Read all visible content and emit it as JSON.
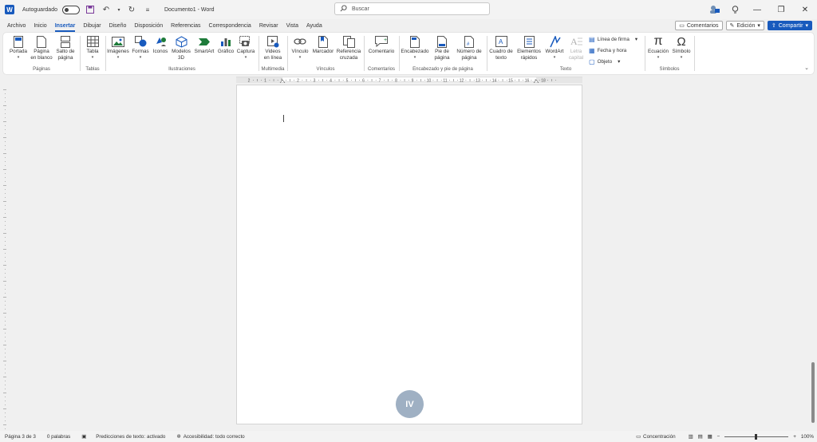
{
  "titlebar": {
    "autosave_label": "Autoguardado",
    "document_title": "Documento1 - Word",
    "search_placeholder": "Buscar"
  },
  "tabs": [
    {
      "label": "Archivo"
    },
    {
      "label": "Inicio"
    },
    {
      "label": "Insertar",
      "active": true
    },
    {
      "label": "Dibujar"
    },
    {
      "label": "Diseño"
    },
    {
      "label": "Disposición"
    },
    {
      "label": "Referencias"
    },
    {
      "label": "Correspondencia"
    },
    {
      "label": "Revisar"
    },
    {
      "label": "Vista"
    },
    {
      "label": "Ayuda"
    }
  ],
  "tabs_right": {
    "comments": "Comentarios",
    "editing": "Edición",
    "share": "Compartir"
  },
  "ribbon": {
    "paginas": {
      "label": "Páginas",
      "portada": "Portada",
      "pagina1": "Página",
      "pagina2": "en blanco",
      "salto1": "Salto de",
      "salto2": "página"
    },
    "tablas": {
      "label": "Tablas",
      "tabla": "Tabla"
    },
    "ilustraciones": {
      "label": "Ilustraciones",
      "imagenes": "Imágenes",
      "formas": "Formas",
      "iconos": "Iconos",
      "modelos1": "Modelos",
      "modelos2": "3D",
      "smartart": "SmartArt",
      "grafico": "Gráfico",
      "captura": "Captura"
    },
    "multimedia": {
      "label": "Multimedia",
      "videos1": "Videos",
      "videos2": "en línea"
    },
    "vinculos": {
      "label": "Vínculos",
      "vinculo": "Vínculo",
      "marcador": "Marcador",
      "ref1": "Referencia",
      "ref2": "cruzada"
    },
    "comentarios": {
      "label": "Comentarios",
      "comentario": "Comentario"
    },
    "encabezado": {
      "label": "Encabezado y pie de página",
      "encabezado": "Encabezado",
      "pie1": "Pie de",
      "pie2": "página",
      "num1": "Número de",
      "num2": "página"
    },
    "texto": {
      "label": "Texto",
      "cuadro1": "Cuadro de",
      "cuadro2": "texto",
      "elem1": "Elementos",
      "elem2": "rápidos",
      "wordart": "WordArt",
      "letra1": "Letra",
      "letra2": "capital",
      "linea_firma": "Línea de firma",
      "fecha_hora": "Fecha y hora",
      "objeto": "Objeto"
    },
    "simbolos": {
      "label": "Símbolos",
      "ecuacion": "Ecuación",
      "simbolo": "Símbolo"
    }
  },
  "ruler_numbers": [
    "2",
    "1",
    "1",
    "2",
    "3",
    "4",
    "5",
    "6",
    "7",
    "8",
    "9",
    "10",
    "11",
    "12",
    "13",
    "14",
    "15",
    "16",
    "18"
  ],
  "document": {
    "page_badge": "IV"
  },
  "statusbar": {
    "page": "Página 3 de 3",
    "words": "0 palabras",
    "predictions": "Predicciones de texto: activado",
    "accessibility": "Accesibilidad: todo correcto",
    "focus": "Concentración",
    "zoom": "100%"
  }
}
